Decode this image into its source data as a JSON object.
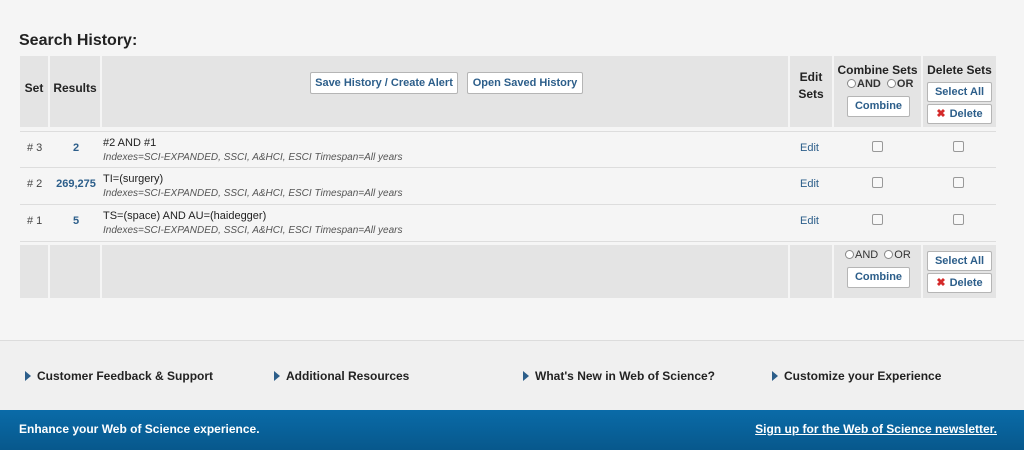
{
  "page_title": "Search History:",
  "table": {
    "headers": {
      "set": "Set",
      "results": "Results",
      "edit_line1": "Edit",
      "edit_line2": "Sets",
      "combine": "Combine Sets",
      "delete": "Delete Sets"
    },
    "save_history_label": "Save History / Create Alert",
    "open_saved_label": "Open Saved History",
    "and_label": "AND",
    "or_label": "OR",
    "combine_label": "Combine",
    "select_all_label": "Select All",
    "delete_label": "Delete",
    "rows": [
      {
        "set": "# 3",
        "results": "2",
        "query": "#2 AND #1",
        "indexes": "Indexes=SCI-EXPANDED, SSCI, A&HCI, ESCI Timespan=All years",
        "edit": "Edit"
      },
      {
        "set": "# 2",
        "results": "269,275",
        "query": "TI=(surgery)",
        "indexes": "Indexes=SCI-EXPANDED, SSCI, A&HCI, ESCI Timespan=All years",
        "edit": "Edit"
      },
      {
        "set": "# 1",
        "results": "5",
        "query": "TS=(space) AND AU=(haidegger)",
        "indexes": "Indexes=SCI-EXPANDED, SSCI, A&HCI, ESCI Timespan=All years",
        "edit": "Edit"
      }
    ]
  },
  "footer_links": {
    "feedback": "Customer Feedback & Support",
    "resources": "Additional Resources",
    "whats_new": "What's New in Web of Science?",
    "customize": "Customize your Experience"
  },
  "banner": {
    "text": "Enhance your Web of Science experience.",
    "link": "Sign up for the Web of Science newsletter."
  },
  "colors": {
    "link": "#2c5e8a",
    "banner": "#0a6ba8",
    "delete_x": "#d42a2a"
  },
  "icons": {
    "footer_arrow": "triangle-right-icon",
    "delete": "x-icon"
  }
}
